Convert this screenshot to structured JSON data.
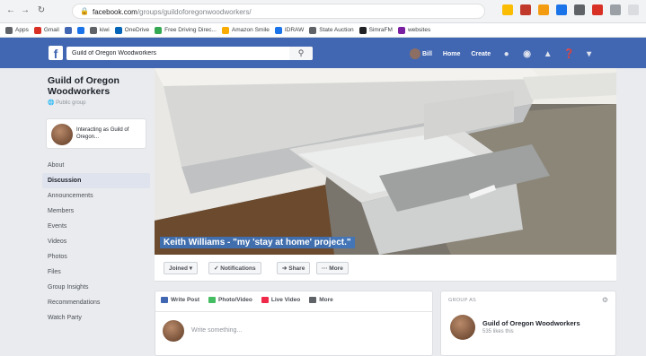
{
  "browser": {
    "url_host": "facebook.com",
    "url_path": "/groups/guildoforegonwoodworkers/",
    "bookmarks": [
      {
        "label": "Apps",
        "icon": "apps-grid-icon",
        "color": "#5f6368"
      },
      {
        "label": "Gmail",
        "icon": "gmail-icon",
        "color": "#d93025"
      },
      {
        "label": "",
        "icon": "facebook-bookmark-icon",
        "color": "#4267b2"
      },
      {
        "label": "",
        "icon": "grid-bookmark-icon",
        "color": "#1a73e8"
      },
      {
        "label": "kiwi",
        "icon": "compass-icon",
        "color": "#5f6368"
      },
      {
        "label": "OneDrive",
        "icon": "cloud-icon",
        "color": "#0364b8"
      },
      {
        "label": "Free Driving Direc...",
        "icon": "directions-icon",
        "color": "#34a853"
      },
      {
        "label": "Amazon Smile",
        "icon": "amazon-icon",
        "color": "#f9ab00"
      },
      {
        "label": "IDRAW",
        "icon": "draw-icon",
        "color": "#1a73e8"
      },
      {
        "label": "State Auction",
        "icon": "auction-icon",
        "color": "#5f6368"
      },
      {
        "label": "SimraFM",
        "icon": "radio-icon",
        "color": "#202124"
      },
      {
        "label": "websites",
        "icon": "folder-icon",
        "color": "#7b1fa2"
      }
    ]
  },
  "fb": {
    "search_value": "Guild of Oregon Woodworkers",
    "user_name": "Bill",
    "nav_home": "Home",
    "nav_create": "Create",
    "brand_color": "#4267b2"
  },
  "sidebar": {
    "group_name": "Guild of Oregon Woodworkers",
    "group_type": "Public group",
    "interacting_as": "Interacting as Guild of Oregon...",
    "items": [
      {
        "label": "About"
      },
      {
        "label": "Discussion"
      },
      {
        "label": "Announcements"
      },
      {
        "label": "Members"
      },
      {
        "label": "Events"
      },
      {
        "label": "Videos"
      },
      {
        "label": "Photos"
      },
      {
        "label": "Files"
      },
      {
        "label": "Group Insights"
      },
      {
        "label": "Recommendations"
      },
      {
        "label": "Watch Party"
      }
    ]
  },
  "cover": {
    "caption": "Keith Williams - \"my 'stay at home' project.\""
  },
  "actions": {
    "joined": "Joined ▾",
    "notifications": "✓ Notifications",
    "share": "➔ Share",
    "more": "··· More"
  },
  "composer": {
    "write_post": "Write Post",
    "photo_video": "Photo/Video",
    "live_video": "Live Video",
    "more": "More",
    "placeholder": "Write something..."
  },
  "right_card": {
    "label": "GROUP AS",
    "name": "Guild of Oregon Woodworkers",
    "sub": "535 likes this"
  }
}
